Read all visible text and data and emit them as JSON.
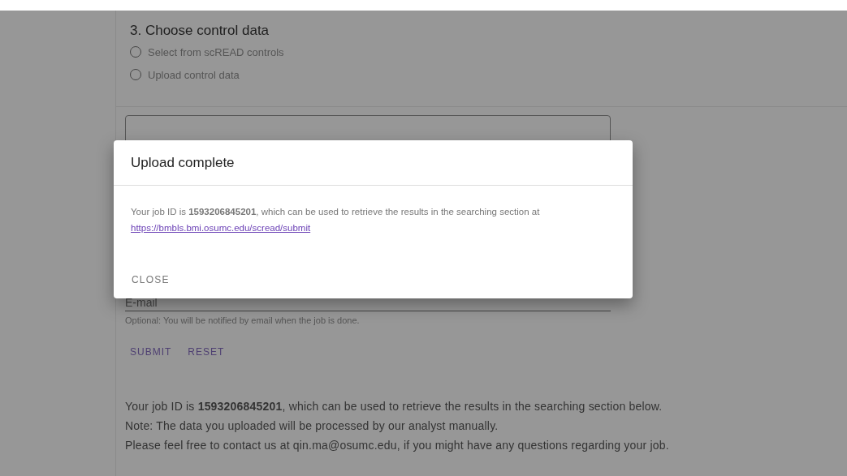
{
  "section": {
    "title": "3. Choose control data",
    "options": [
      {
        "label": "Select from scREAD controls",
        "selected": false
      },
      {
        "label": "Upload control data",
        "selected": false
      }
    ]
  },
  "email_field": {
    "placeholder": "E-mail",
    "helper": "Optional: You will be notified by email when the job is done."
  },
  "buttons": [
    "SUBMIT",
    "RESET"
  ],
  "messages": [
    "Your job ID is **1593206845201**, which can be used to retrieve the results in the searching section below.",
    "Note: The data you uploaded will be processed by our analyst manually.",
    "Please feel free to contact us at qin.ma@osumc.edu, if you might have any questions regarding your job."
  ],
  "dialog": {
    "title": "Upload complete",
    "text": "Your job ID is **1593206845201**, which can be used to retrieve the results in the searching section at",
    "link": "https://bmbls.bmi.osumc.edu/scread/submit",
    "button": "CLOSE"
  }
}
